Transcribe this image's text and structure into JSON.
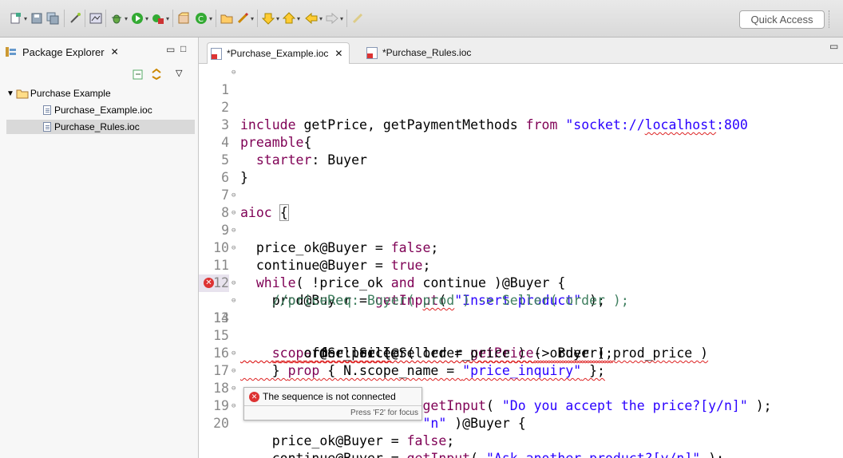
{
  "toolbar": {
    "quick_access": "Quick Access",
    "icons": [
      "new-icon",
      "save-icon",
      "save-all-icon",
      "wand-icon",
      "perspective-icon",
      "bug-icon",
      "run-icon",
      "external-tools-icon",
      "new-project-icon",
      "new-class-icon",
      "open-folder-icon",
      "pencil-icon",
      "next-annotation-icon",
      "prev-annotation-icon",
      "back-icon",
      "forward-icon",
      "highlight-icon"
    ]
  },
  "package_explorer": {
    "tab_label": "Package Explorer",
    "project": "Purchase Example",
    "files": [
      "Purchase_Example.ioc",
      "Purchase_Rules.ioc"
    ]
  },
  "editor": {
    "tabs": [
      {
        "label": "*Purchase_Example.ioc"
      },
      {
        "label": "*Purchase_Rules.ioc"
      }
    ],
    "lines": [
      {
        "n": "1",
        "text": "include getPrice, getPaymentMethods from \"socket://localhost:800"
      },
      {
        "n": "2",
        "text": ""
      },
      {
        "n": "3",
        "text": "preamble{"
      },
      {
        "n": "4",
        "text": "  starter: Buyer"
      },
      {
        "n": "5",
        "text": "}"
      },
      {
        "n": "6",
        "text": ""
      },
      {
        "n": "7",
        "text": "aioc {"
      },
      {
        "n": "8",
        "text": "  price_ok@Buyer = false;"
      },
      {
        "n": "9",
        "text": "  continue@Buyer = true;"
      },
      {
        "n": "10",
        "text": "  while( !price_ok and continue )@Buyer {"
      },
      {
        "n": "11",
        "text": "    prod@Buyer = getInput( \"Insert product\" );"
      },
      {
        "n": "12",
        "text": "    //priceReq: Buyer( prod ) -> Seller( order );"
      },
      {
        "n": "13",
        "text": "    scope @Seller {"
      },
      {
        "n": "14",
        "text": "        order_price@Seller = getPrice( order );"
      },
      {
        "n": "15",
        "text": "        offer: Seller( order_price ) -> Buyer( prod_price )"
      },
      {
        "n": "16",
        "text": "    } prop { N.scope_name = \"price_inquiry\" };"
      },
      {
        "n": "17",
        "text": "                       getInput( \"Do you accept the price?[y/n]\" );"
      },
      {
        "n": "18",
        "text": "                       \"n\" )@Buyer {"
      },
      {
        "n": "19",
        "text": "    price_ok@Buyer = false;"
      },
      {
        "n": "20",
        "text": "    continue@Buyer = getInput( \"Ask another product?[y/n]\" );"
      }
    ]
  },
  "tooltip": {
    "message": "The sequence is not connected",
    "footer": "Press 'F2' for focus"
  }
}
